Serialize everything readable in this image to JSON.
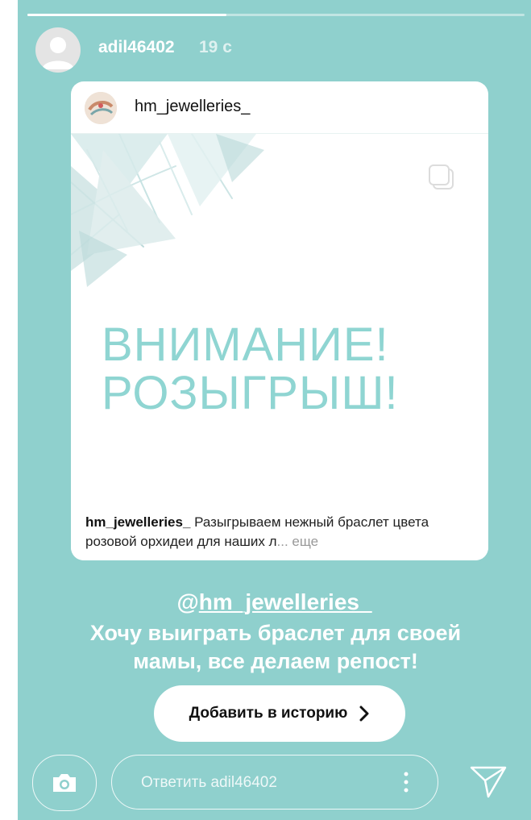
{
  "story": {
    "progress": 0.4,
    "username": "adil46402",
    "time_ago": "19 с"
  },
  "shared_post": {
    "username": "hm_jewelleries_",
    "headline_line1": "ВНИМАНИЕ!",
    "headline_line2": "РОЗЫГРЫШ!",
    "caption_user": "hm_jewelleries_",
    "caption_text": " Разыгрываем нежный браслет цвета розовой орхидеи для наших л",
    "caption_more": "... еще"
  },
  "story_text": {
    "mention_at": "@",
    "mention_handle": "hm_jewelleries_",
    "message_line1": "Хочу выиграть браслет для своей",
    "message_line2": "мамы, все делаем репост!"
  },
  "add_to_story_button": {
    "label": "Добавить в историю"
  },
  "reply_bar": {
    "placeholder": "Ответить adil46402"
  },
  "colors": {
    "background": "#8fd0cd",
    "headline": "#8fd5d2"
  },
  "icons": [
    "camera-icon",
    "more-vertical-icon",
    "send-icon",
    "multiple-posts-icon",
    "chevron-right-icon"
  ]
}
